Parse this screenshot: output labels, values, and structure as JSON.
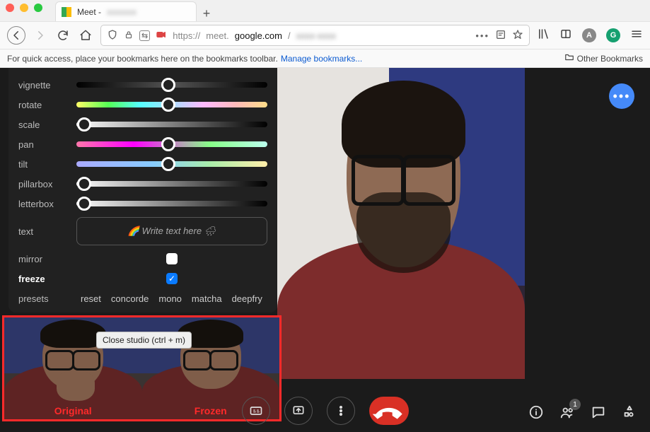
{
  "browser": {
    "tab_title_prefix": "Meet - ",
    "tab_title_blur": "xxxxxxx",
    "url_protocol": "https://",
    "url_subdomain": "meet.",
    "url_domain": "google.com",
    "url_path": "/",
    "url_path_blur": "xxxx-xxxx",
    "bookmark_hint": "For quick access, place your bookmarks here on the bookmarks toolbar.",
    "bookmark_link": "Manage bookmarks...",
    "other_bookmarks": "Other Bookmarks"
  },
  "panel": {
    "sliders": [
      {
        "label": "vignette",
        "value": 48,
        "gradient": "g-dark"
      },
      {
        "label": "rotate",
        "value": 48,
        "gradient": "g-rainbow"
      },
      {
        "label": "scale",
        "value": 4,
        "gradient": "g-gray"
      },
      {
        "label": "pan",
        "value": 48,
        "gradient": "g-pan"
      },
      {
        "label": "tilt",
        "value": 48,
        "gradient": "g-tilt"
      },
      {
        "label": "pillarbox",
        "value": 4,
        "gradient": "g-gray"
      },
      {
        "label": "letterbox",
        "value": 4,
        "gradient": "g-gray"
      }
    ],
    "text_label": "text",
    "text_placeholder": "🌈 Write text here 🌧",
    "mirror_label": "mirror",
    "mirror_checked": false,
    "freeze_label": "freeze",
    "freeze_checked": true,
    "presets_label": "presets",
    "presets": [
      "reset",
      "concorde",
      "mono",
      "matcha",
      "deepfry"
    ]
  },
  "studio": {
    "tooltip": "Close studio (ctrl + m)",
    "original": "Original",
    "frozen": "Frozen"
  },
  "meet": {
    "participant_count": "1"
  }
}
